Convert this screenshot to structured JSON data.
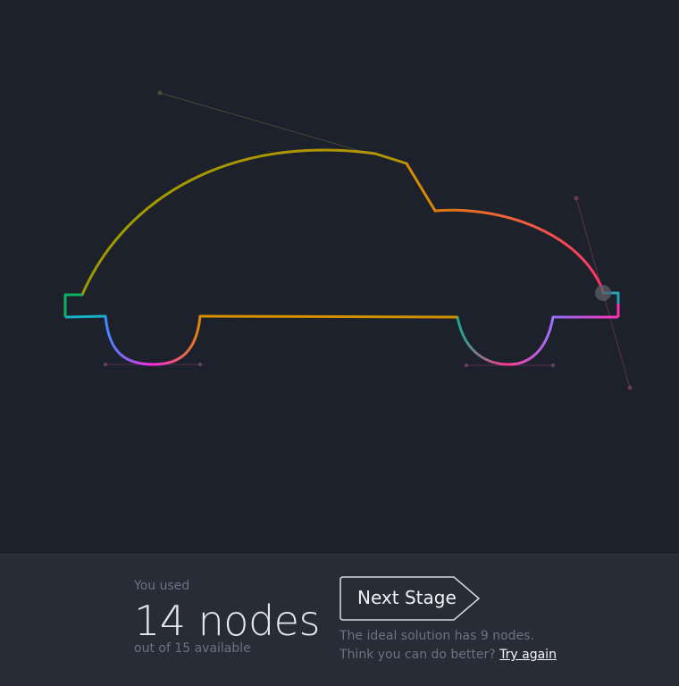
{
  "game": {
    "colors": {
      "background": "#1c212c",
      "footer_background": "#272c37",
      "handle_line": "#4a4a3a",
      "handle_line_pink": "#5a3446",
      "stroke_yellow": "#a79700",
      "stroke_orange": "#e08a00",
      "stroke_pink": "#ff3d7a",
      "stroke_magenta": "#ff29e0",
      "stroke_cyan": "#00a8c8",
      "stroke_green": "#00b050"
    },
    "active_node": "node-rear-bumper"
  },
  "footer": {
    "used_label": "You used",
    "nodes_used": "14 nodes",
    "available_label": "out of 15 available",
    "next_stage_label": "Next Stage",
    "hint_text": "The ideal solution has 9 nodes. Think you can do better?",
    "try_again_label": "Try again"
  }
}
